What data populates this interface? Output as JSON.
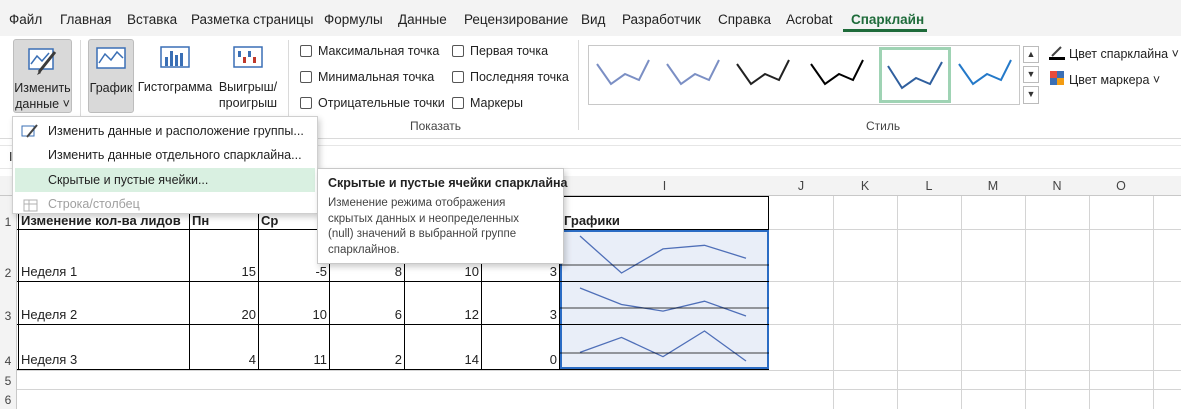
{
  "tabs": [
    "Файл",
    "Главная",
    "Вставка",
    "Разметка страницы",
    "Формулы",
    "Данные",
    "Рецензирование",
    "Вид",
    "Разработчик",
    "Справка",
    "Acrobat",
    "Спарклайн"
  ],
  "ribbon": {
    "edit_data": {
      "line1": "Изменить",
      "line2": "данные ˅"
    },
    "type_line": "График",
    "type_column": "Гистограмма",
    "type_winloss": {
      "line1": "Выигрыш/",
      "line2": "проигрыш"
    },
    "show": {
      "checks": [
        "Максимальная точка",
        "Минимальная точка",
        "Отрицательные точки",
        "Первая точка",
        "Последняя точка",
        "Маркеры"
      ],
      "group_label": "Показать"
    },
    "style": {
      "group_label": "Стиль",
      "swatch_colors": [
        "#7b8fc4",
        "#7b8fc4",
        "#222222",
        "#000000",
        "#2f5f9e",
        "#2479c9"
      ]
    },
    "sparkline_color": "Цвет спарклайна ˅",
    "marker_color": "Цвет маркера ˅"
  },
  "menu": {
    "items": [
      "Изменить данные и расположение группы...",
      "Изменить данные отдельного спарклайна...",
      "Скрытые и пустые ячейки...",
      "Строка/столбец"
    ]
  },
  "tooltip": {
    "title": "Скрытые и пустые ячейки спарклайна",
    "lines": [
      "Изменение режима отображения",
      "скрытых данных и неопределенных",
      "(null) значений в выбранной группе",
      "спарклайнов."
    ]
  },
  "formula_prefix": "I",
  "columns": [
    "I",
    "J",
    "K",
    "L",
    "M",
    "N",
    "O"
  ],
  "row_numbers": [
    "1",
    "2",
    "3",
    "4",
    "5",
    "6"
  ],
  "sheet": {
    "header": {
      "title": "Изменение кол-ва лидов",
      "mon": "Пн",
      "wed": "Ср",
      "charts": "Графики"
    },
    "rows": [
      {
        "label": "Неделя 1",
        "values": [
          "15",
          "-5",
          "8",
          "10",
          "3"
        ]
      },
      {
        "label": "Неделя 2",
        "values": [
          "20",
          "10",
          "6",
          "12",
          "3"
        ]
      },
      {
        "label": "Неделя 3",
        "values": [
          "4",
          "11",
          "2",
          "14",
          "0"
        ]
      }
    ]
  },
  "sparkline_color_hex": "#4f6fb8",
  "chart_data": {
    "type": "line",
    "series": [
      {
        "values": [
          15,
          -5,
          8,
          10,
          3
        ]
      },
      {
        "values": [
          20,
          10,
          6,
          12,
          3
        ]
      },
      {
        "values": [
          4,
          11,
          2,
          14,
          0
        ]
      }
    ]
  }
}
